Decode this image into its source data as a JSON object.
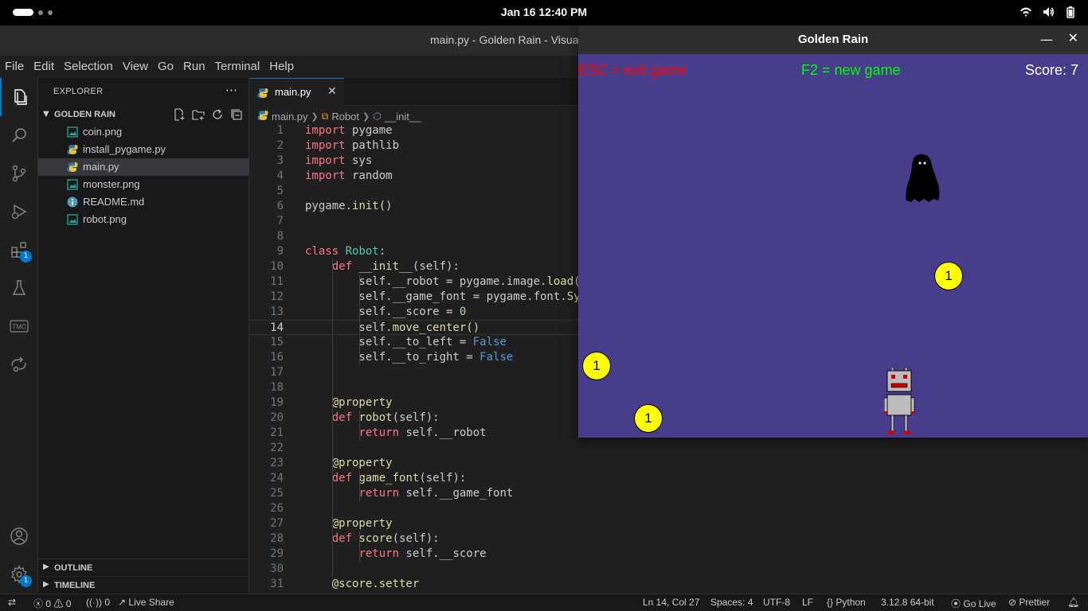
{
  "system": {
    "clock": "Jan 16  12:40 PM"
  },
  "window": {
    "title": "main.py - Golden Rain - Visual Studio Code"
  },
  "menu": [
    "File",
    "Edit",
    "Selection",
    "View",
    "Go",
    "Run",
    "Terminal",
    "Help"
  ],
  "activity": {
    "extensions_badge": "1",
    "settings_badge": "1"
  },
  "sidebar": {
    "title": "EXPLORER",
    "folder": "GOLDEN RAIN",
    "files": [
      {
        "name": "coin.png",
        "icon": "image-icon"
      },
      {
        "name": "install_pygame.py",
        "icon": "python-icon"
      },
      {
        "name": "main.py",
        "icon": "python-icon"
      },
      {
        "name": "monster.png",
        "icon": "image-icon"
      },
      {
        "name": "README.md",
        "icon": "info-icon"
      },
      {
        "name": "robot.png",
        "icon": "image-icon"
      }
    ],
    "outline": "OUTLINE",
    "timeline": "TIMELINE"
  },
  "editor": {
    "tab": "main.py",
    "breadcrumb": [
      "main.py",
      "Robot",
      "__init__"
    ],
    "current_line": 14
  },
  "code": [
    "import pygame",
    "import pathlib",
    "import sys",
    "import random",
    "",
    "pygame.init()",
    "",
    "",
    "class Robot:",
    "    def __init__(self):",
    "        self.__robot = pygame.image.load(",
    "        self.__game_font = pygame.font.Sy",
    "        self.__score = 0",
    "        self.move_center()",
    "        self.__to_left = False",
    "        self.__to_right = False",
    "",
    "",
    "    @property",
    "    def robot(self):",
    "        return self.__robot",
    "",
    "    @property",
    "    def game_font(self):",
    "        return self.__game_font",
    "",
    "    @property",
    "    def score(self):",
    "        return self.__score",
    "",
    "    @score.setter"
  ],
  "status": {
    "errors": "0",
    "warnings": "0",
    "ports": "0",
    "live_share": "Live Share",
    "position": "Ln 14, Col 27",
    "spaces": "Spaces: 4",
    "encoding": "UTF-8",
    "eol": "LF",
    "language": "Python",
    "interpreter": "3.12.8 64-bit",
    "go_live": "Go Live",
    "prettier": "Prettier"
  },
  "game": {
    "title": "Golden Rain",
    "hud_exit": "ESC = exit game",
    "hud_new": "F2 = new game",
    "score": "Score: 7",
    "coin_label": "1",
    "background_color": "#483d8b",
    "exit_color": "#ff0000",
    "new_color": "#00ff00"
  }
}
